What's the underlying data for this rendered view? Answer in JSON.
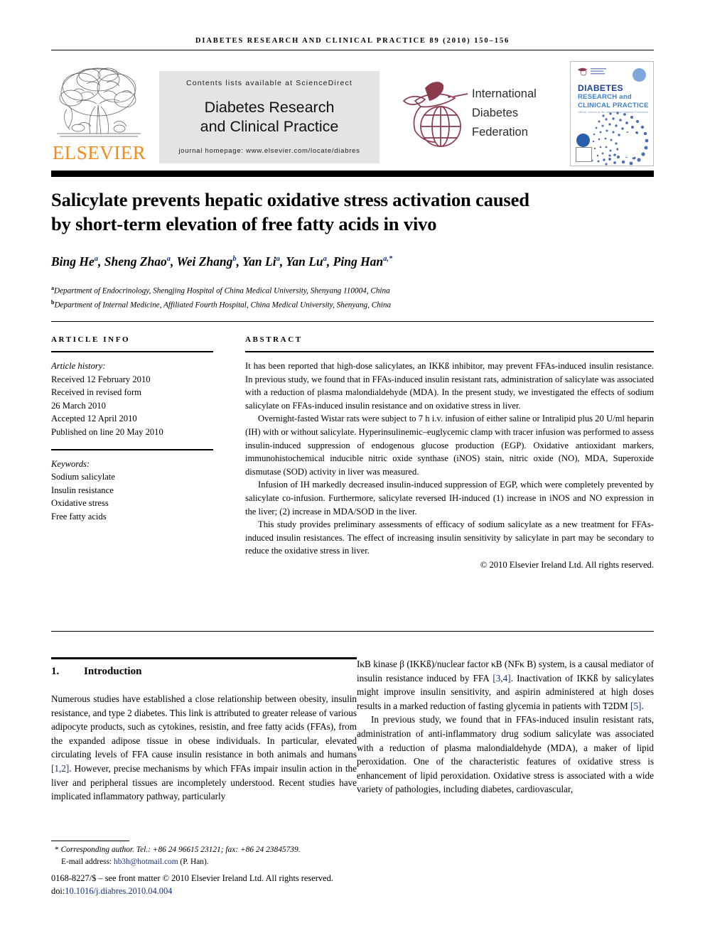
{
  "running_head": "diabetes research and clinical practice 89 (2010) 150–156",
  "masthead": {
    "elsevier_wordmark": "ELSEVIER",
    "contents_line": "Contents lists available at ScienceDirect",
    "journal_title_line1": "Diabetes Research",
    "journal_title_line2": "and Clinical Practice",
    "homepage_line": "journal homepage: www.elsevier.com/locate/diabres",
    "idf_line1": "International",
    "idf_line2": "Diabetes",
    "idf_line3": "Federation",
    "cover": {
      "title_main": "DIABETES",
      "title_sub1": "RESEARCH and",
      "title_sub2": "CLINICAL PRACTICE",
      "tagline": "Official Journal of the International Diabetes Federation"
    },
    "colors": {
      "elsevier_orange": "#F08C1E",
      "idf_maroon": "#8C3A4E",
      "cover_navy": "#1c3f94",
      "cover_blue": "#3f7fc8",
      "panel_grey": "#e4e4e4"
    }
  },
  "article": {
    "title_line1": "Salicylate prevents hepatic oxidative stress activation caused",
    "title_line2": "by short-term elevation of free fatty acids in vivo",
    "authors_html": "Bing He<sup>a</sup>, Sheng Zhao<sup>a</sup>, Wei Zhang<sup>b</sup>, Yan Li<sup>a</sup>, Yan Lu<sup>a</sup>, Ping Han<sup>a,*</sup>",
    "affiliation_a": "Department of Endocrinology, Shengjing Hospital of China Medical University, Shenyang 110004, China",
    "affiliation_b": "Department of Internal Medicine, Affiliated Fourth Hospital, China Medical University, Shenyang, China"
  },
  "article_info": {
    "heading": "ARTICLE INFO",
    "history_label": "Article history:",
    "history_lines": [
      "Received 12 February 2010",
      "Received in revised form",
      "26 March 2010",
      "Accepted 12 April 2010",
      "Published on line 20 May 2010"
    ],
    "keywords_label": "Keywords:",
    "keywords": [
      "Sodium salicylate",
      "Insulin resistance",
      "Oxidative stress",
      "Free fatty acids"
    ]
  },
  "abstract": {
    "heading": "ABSTRACT",
    "paragraphs": [
      "It has been reported that high-dose salicylates, an IKKß inhibitor, may prevent FFAs-induced insulin resistance. In previous study, we found that in FFAs-induced insulin resistant rats, administration of salicylate was associated with a reduction of plasma malondialdehyde (MDA). In the present study, we investigated the effects of sodium salicylate on FFAs-induced insulin resistance and on oxidative stress in liver.",
      "Overnight-fasted Wistar rats were subject to 7 h i.v. infusion of either saline or Intralipid plus 20 U/ml heparin (IH) with or without salicylate. Hyperinsulinemic–euglycemic clamp with tracer infusion was performed to assess insulin-induced suppression of endogenous glucose production (EGP). Oxidative antioxidant markers, immunohistochemical inducible nitric oxide synthase (iNOS) stain, nitric oxide (NO), MDA, Superoxide dismutase (SOD) activity in liver was measured.",
      "Infusion of IH markedly decreased insulin-induced suppression of EGP, which were completely prevented by salicylate co-infusion. Furthermore, salicylate reversed IH-induced (1) increase in iNOS and NO expression in the liver; (2) increase in MDA/SOD in the liver.",
      "This study provides preliminary assessments of efficacy of sodium salicylate as a new treatment for FFAs-induced insulin resistances. The effect of increasing insulin sensitivity by salicylate in part may be secondary to reduce the oxidative stress in liver."
    ],
    "copyright": "© 2010 Elsevier Ireland Ltd. All rights reserved."
  },
  "introduction": {
    "number": "1.",
    "heading": "Introduction",
    "left_paragraph": "Numerous studies have established a close relationship between obesity, insulin resistance, and type 2 diabetes. This link is attributed to greater release of various adipocyte products, such as cytokines, resistin, and free fatty acids (FFAs), from the expanded adipose tissue in obese individuals. In particular, elevated circulating levels of FFA cause insulin resistance in both animals and humans ",
    "left_ref_1": "[1,2]",
    "left_paragraph_cont": ". However, precise mechanisms by which FFAs impair insulin action in the liver and peripheral tissues are incompletely understood. Recent studies have implicated inflammatory pathway, particularly",
    "right_paragraph_1a": "IκB kinase β (IKKß)/nuclear factor κB (NFκ B) system, is a causal mediator of insulin resistance induced by FFA ",
    "right_ref_1": "[3,4]",
    "right_paragraph_1b": ". Inactivation of IKKß by salicylates might improve insulin sensitivity, and aspirin administered at high doses results in a marked reduction of fasting glycemia in patients with T2DM ",
    "right_ref_2": "[5]",
    "right_paragraph_1c": ".",
    "right_paragraph_2": "In previous study, we found that in FFAs-induced insulin resistant rats, administration of anti-inflammatory drug sodium salicylate was associated with a reduction of plasma malondialdehyde (MDA), a maker of lipid peroxidation. One of the characteristic features of oxidative stress is enhancement of lipid peroxidation. Oxidative stress is associated with a wide variety of pathologies, including diabetes, cardiovascular,"
  },
  "footer": {
    "corresponding_marker": "*",
    "corresponding_text": "Corresponding author. Tel.: +86 24 96615 23121; fax: +86 24 23845739.",
    "email_label": "E-mail address:",
    "email": "hb3h@hotmail.com",
    "email_owner": "(P. Han).",
    "front_matter": "0168-8227/$ – see front matter © 2010 Elsevier Ireland Ltd. All rights reserved.",
    "doi_label": "doi:",
    "doi": "10.1016/j.diabres.2010.04.004"
  }
}
